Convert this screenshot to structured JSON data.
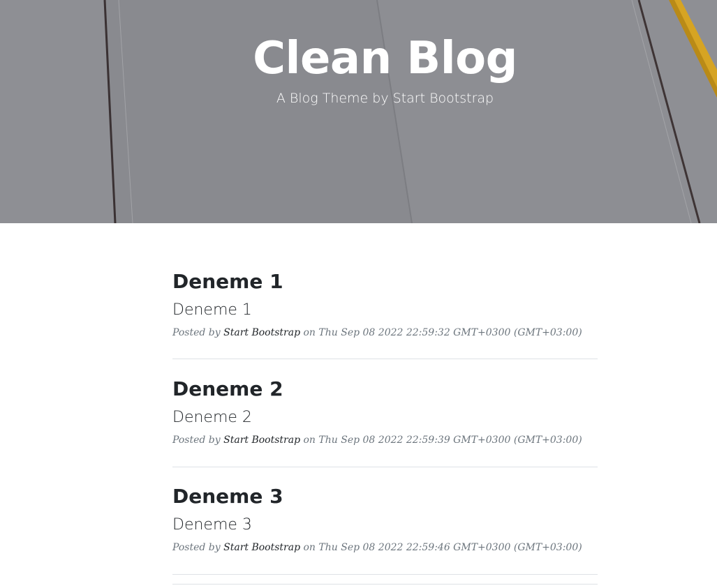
{
  "header": {
    "title": "Clean Blog",
    "subtitle": "A Blog Theme by Start Bootstrap"
  },
  "posts": [
    {
      "title": "Deneme 1",
      "subtitle": "Deneme 1",
      "posted_by": "Posted by",
      "author": "Start Bootstrap",
      "on": "on",
      "date": "Thu Sep 08 2022 22:59:32 GMT+0300 (GMT+03:00)"
    },
    {
      "title": "Deneme 2",
      "subtitle": "Deneme 2",
      "posted_by": "Posted by",
      "author": "Start Bootstrap",
      "on": "on",
      "date": "Thu Sep 08 2022 22:59:39 GMT+0300 (GMT+03:00)"
    },
    {
      "title": "Deneme 3",
      "subtitle": "Deneme 3",
      "posted_by": "Posted by",
      "author": "Start Bootstrap",
      "on": "on",
      "date": "Thu Sep 08 2022 22:59:46 GMT+0300 (GMT+03:00)"
    }
  ],
  "colors": {
    "masthead_overlay": "#8a8b90",
    "text_dark": "#212529",
    "text_muted": "#6c757d",
    "divider": "#dee2e6"
  }
}
